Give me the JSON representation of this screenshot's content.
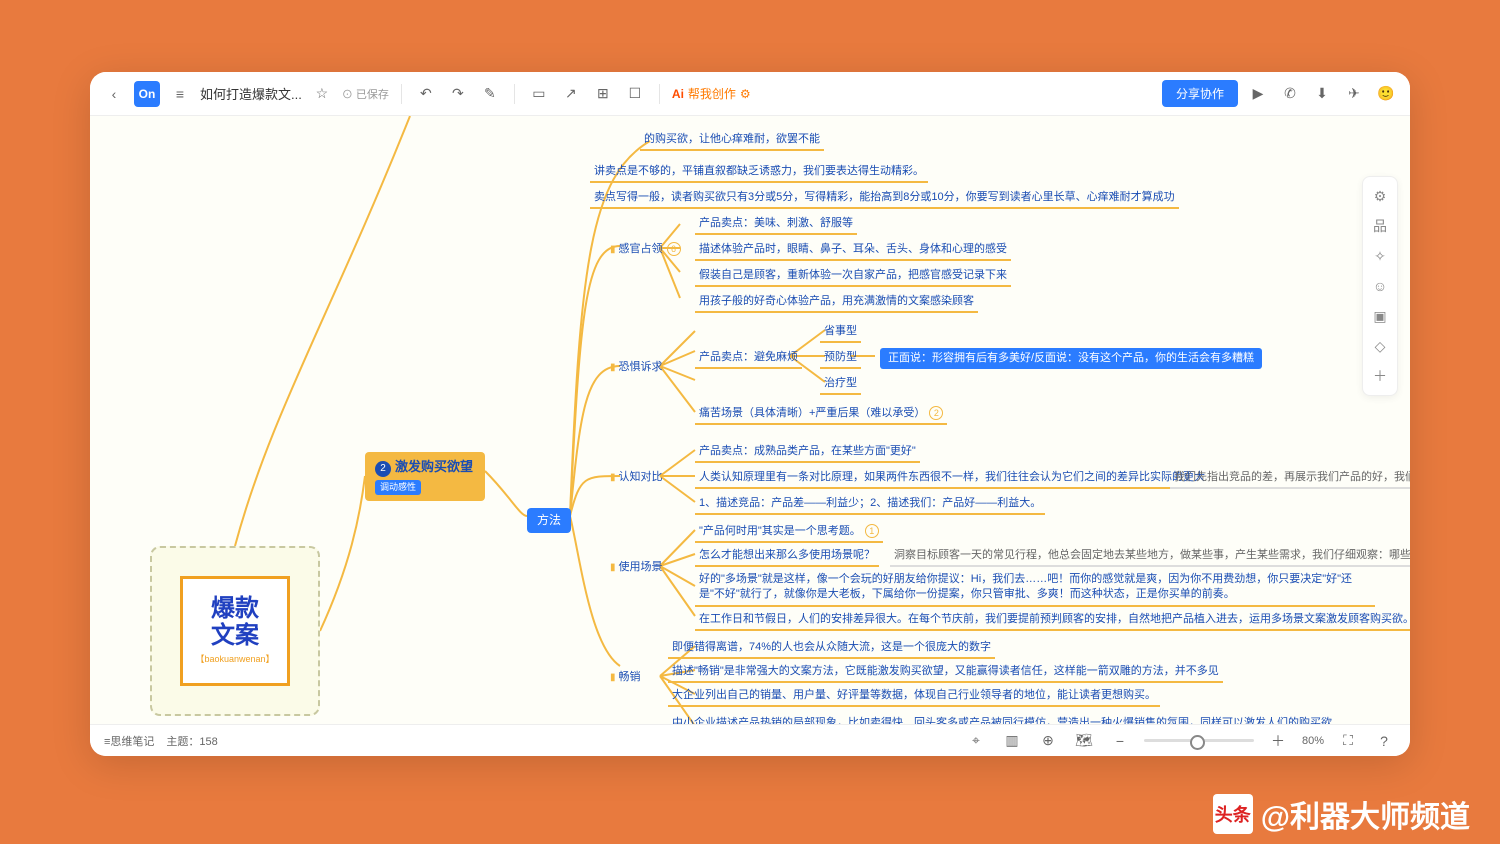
{
  "toolbar": {
    "logo": "On",
    "title": "如何打造爆款文...",
    "saved": "已保存",
    "ai": "帮我创作",
    "share": "分享协作"
  },
  "root": {
    "line1": "爆款",
    "line2": "文案",
    "pinyin": "【baokuanwenan】"
  },
  "node2": {
    "num": "2",
    "title": "激发购买欲望",
    "tag": "调动感性"
  },
  "method": "方法",
  "topLeaves": [
    "的购买欲，让他心痒难耐，欲罢不能",
    "讲卖点是不够的，平铺直叙都缺乏诱惑力，我们要表达得生动精彩。",
    "卖点写得一般，读者购买欲只有3分或5分，写得精彩，能抬高到8分或10分，你要写到读者心里长草、心痒难耐才算成功"
  ],
  "branches": {
    "sense": {
      "label": "感官占领",
      "badge": "6",
      "items": [
        "产品卖点：美味、刺激、舒服等",
        "描述体验产品时，眼睛、鼻子、耳朵、舌头、身体和心理的感受",
        "假装自己是顾客，重新体验一次自家产品，把感官感受记录下来",
        "用孩子般的好奇心体验产品，用充满激情的文案感染顾客"
      ]
    },
    "fear": {
      "label": "恐惧诉求",
      "sellpoint": "产品卖点：避免麻烦",
      "types": [
        "省事型",
        "预防型",
        "治疗型"
      ],
      "blue": "正面说：形容拥有后有多美好/反面说：没有这个产品，你的生活会有多糟糕",
      "pain": "痛苦场景（具体清晰）+严重后果（难以承受）",
      "painBadge": "2"
    },
    "cognition": {
      "label": "认知对比",
      "items": [
        "产品卖点：成熟品类产品，在某些方面\"更好\"",
        "人类认知原理里有一条对比原理，如果两件东西很不一样，我们往往会认为它们之间的差异比实际的更大",
        "1、描述竞品：产品差——利益少；2、描述我们：产品好——利益大。"
      ],
      "right": "我们先指出竞品的差，再展示我们产品的好，我们"
    },
    "scene": {
      "label": "使用场景",
      "badge": "1",
      "items": [
        "\"产品何时用\"其实是一个思考题。",
        "怎么才能想出来那么多使用场景呢？",
        "好的\"多场景\"就是这样，像一个会玩的好朋友给你提议：Hi，我们去……吧！而你的感觉就是爽，因为你不用费劲想，你只要决定\"好\"还是\"不好\"就行了，就像你是大老板，下属给你一份提案，你只管审批、多爽！而这种状态，正是你买单的前奏。",
        "在工作日和节假日，人们的安排差异很大。在每个节庆前，我们要提前预判顾客的安排，自然地把产品植入进去，运用多场景文案激发顾客购买欲。"
      ],
      "right": "洞察目标顾客一天的常见行程，他总会固定地去某些地方，做某些事，产生某些需求，我们仔细观察：哪些场景下，他"
    },
    "sales": {
      "label": "畅销",
      "items": [
        "即便错得离谱，74%的人也会从众随大流，这是一个很庞大的数字",
        "描述\"畅销\"是非常强大的文案方法，它既能激发购买欲望，又能赢得读者信任，这样能一箭双雕的方法，并不多见",
        "大企业列出自己的销量、用户量、好评量等数据，体现自己行业领导者的地位，能让读者更想购买。",
        "中小企业描述产品热销的局部现象，比如卖得快、回头客多或产品被同行模仿，营造出一种火爆销售的氛围，同样可以激发人们的购买欲"
      ]
    }
  },
  "status": {
    "left": "思维笔记",
    "topics_label": "主题：",
    "topics": "158",
    "zoom": "80%"
  },
  "watermark": {
    "brand": "头条",
    "handle": "@利器大师频道"
  }
}
